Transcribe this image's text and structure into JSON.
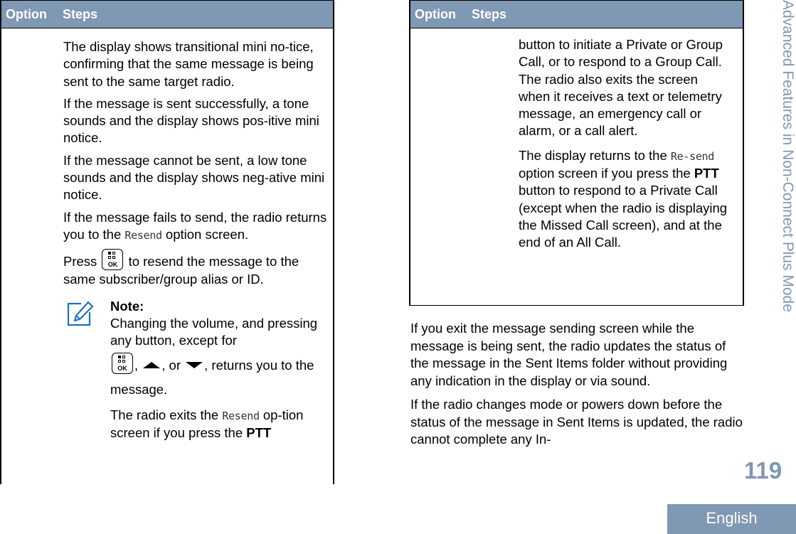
{
  "table_header": {
    "option": "Option",
    "steps": "Steps"
  },
  "left_table": {
    "p1": "The display shows transitional mini no-tice, confirming that the same message is being sent to the same target radio.",
    "p2": "If the message is sent successfully, a tone sounds and the display shows pos-itive mini notice.",
    "p3": "If the message cannot be sent, a low tone sounds and the display shows neg-ative mini notice.",
    "p4_pre": "If the message fails to send, the radio returns you to the ",
    "p4_code": "Resend",
    "p4_post": " option screen.",
    "p5_pre": "Press ",
    "p5_post": " to resend the message to the same subscriber/group alias or ID.",
    "ok_key_label": "OK",
    "note": {
      "title": "Note:",
      "line1": "Changing the volume, and pressing any button, except for",
      "sep1": ", ",
      "sep2": ", or ",
      "line2_post": ", returns you to the message.",
      "p2_pre": "The radio exits the ",
      "p2_code": "Resend",
      "p2_mid": " op-tion screen if you press the ",
      "p2_bold": "PTT"
    }
  },
  "right_table": {
    "p1": "button to initiate a Private or Group Call, or to respond to a Group Call. The radio also exits the screen when it receives a text or telemetry message, an emergency call or alarm, or a call alert.",
    "p2_pre": "The display returns to the ",
    "p2_code": "Re-send",
    "p2_mid": " option screen if you press the ",
    "p2_bold": "PTT",
    "p2_post": " button to respond to a Private Call (except when the radio is displaying the Missed Call screen), and at the end of an All Call."
  },
  "body_right": {
    "p1": "If you exit the message sending screen while the message is being sent, the radio updates the status of the message in the Sent Items folder without providing any indication in the display or via sound.",
    "p2": "If the radio changes mode or powers down before the status of the message in Sent Items is updated, the radio cannot complete any In-"
  },
  "side_title": "Advanced Features in Non-Connect Plus Mode",
  "page_number": "119",
  "language_tab": "English",
  "colors": {
    "accent": "#7f98b3",
    "note_icon": "#1f6fbf"
  },
  "icons": {
    "ok_key": "menu-ok-key-icon",
    "up": "up-arrow-icon",
    "down": "down-arrow-icon",
    "note": "note-pencil-icon"
  }
}
